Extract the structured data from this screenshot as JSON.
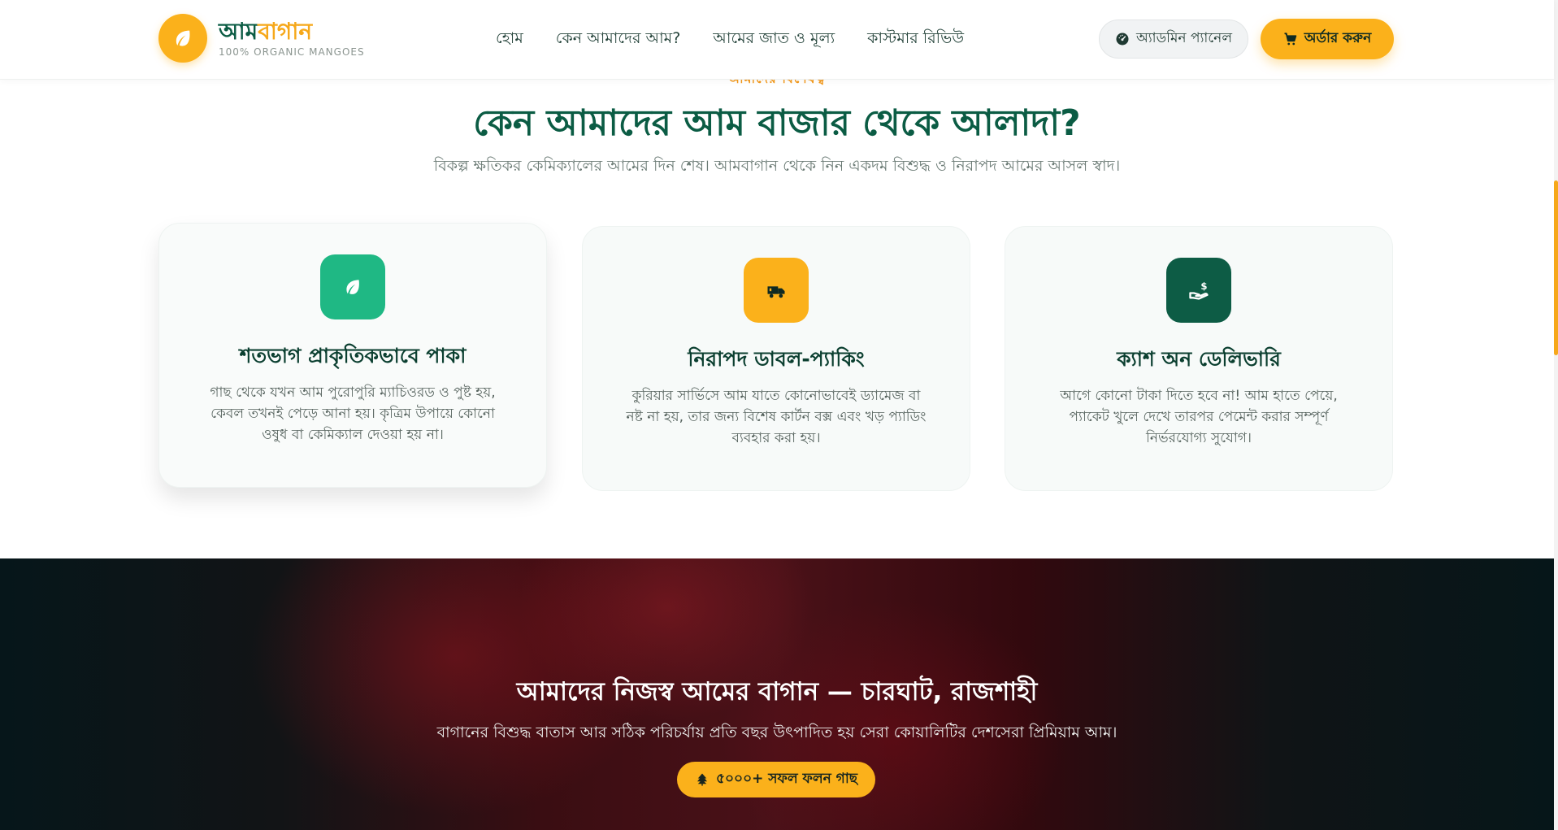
{
  "header": {
    "brand_part1": "আম",
    "brand_part2": "বাগান",
    "tagline": "100% ORGANIC MANGOES",
    "logo_icon": "leaf-icon",
    "nav": [
      {
        "label": "হোম"
      },
      {
        "label": "কেন আমাদের আম?"
      },
      {
        "label": "আমের জাত ও মূল্য"
      },
      {
        "label": "কাস্টমার রিভিউ"
      }
    ],
    "admin_label": "অ্যাডমিন প্যানেল",
    "admin_icon": "gauge-icon",
    "order_label": "অর্ডার করুন",
    "order_icon": "cart-icon"
  },
  "why": {
    "eyebrow": "আমাদের বিশেষত্ব",
    "title": "কেন আমাদের আম বাজার থেকে আলাদা?",
    "subtitle": "বিকল্প ক্ষতিকর কেমিক্যালের আমের দিন শেষ। আমবাগান থেকে নিন একদম বিশুদ্ধ ও নিরাপদ আমের আসল স্বাদ।",
    "cards": [
      {
        "icon": "leaf-icon",
        "color": "#1fb884",
        "title": "শতভাগ প্রাকৃতিকভাবে পাকা",
        "text": "গাছ থেকে যখন আম পুরোপুরি ম্যাচিওরড ও পুষ্ট হয়, কেবল তখনই পেড়ে আনা হয়। কৃত্রিম উপায়ে কোনো ওষুধ বা কেমিক্যাল দেওয়া হয় না।"
      },
      {
        "icon": "truck-icon",
        "color": "#fbb11b",
        "title": "নিরাপদ ডাবল-প্যাকিং",
        "text": "কুরিয়ার সার্ভিসে আম যাতে কোনোভাবেই ড্যামেজ বা নষ্ট না হয়, তার জন্য বিশেষ কার্টন বক্স এবং খড় প্যাডিং ব্যবহার করা হয়।"
      },
      {
        "icon": "cash-hand-icon",
        "color": "#0d5c45",
        "title": "ক্যাশ অন ডেলিভারি",
        "text": "আগে কোনো টাকা দিতে হবে না! আম হাতে পেয়ে, প্যাকেট খুলে দেখে তারপর পেমেন্ট করার সম্পূর্ণ নির্ভরযোগ্য সুযোগ।"
      }
    ]
  },
  "garden": {
    "title": "আমাদের নিজস্ব আমের বাগান — চারঘাট, রাজশাহী",
    "subtitle": "বাগানের বিশুদ্ধ বাতাস আর সঠিক পরিচর্যায় প্রতি বছর উৎপাদিত হয় সেরা কোয়ালিটির দেশসেরা প্রিমিয়াম আম।",
    "badge": "৫০০০+ সফল ফলন গাছ",
    "badge_icon": "tree-icon"
  },
  "colors": {
    "brand_green": "#0b5c44",
    "accent_orange": "#fbb11b"
  }
}
